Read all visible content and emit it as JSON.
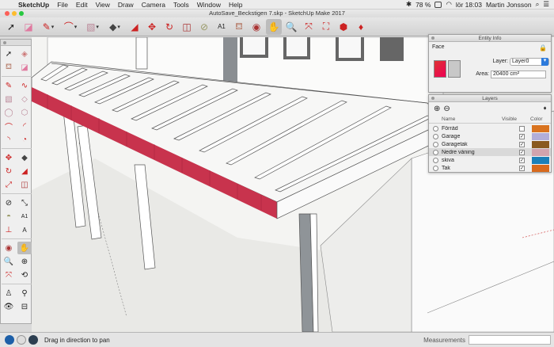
{
  "menubar": {
    "app": "SketchUp",
    "items": [
      "File",
      "Edit",
      "View",
      "Draw",
      "Camera",
      "Tools",
      "Window",
      "Help"
    ],
    "battery": "78 %",
    "clock": "lör 18:03",
    "user": "Martin Jonsson"
  },
  "window": {
    "title": "AutoSave_Beckstigen 7.skp - SketchUp Make 2017"
  },
  "toolbar_icons": [
    "select-icon",
    "eraser-icon",
    "pencil-icon",
    "arc-icon",
    "rectangle-icon",
    "push-pull-icon",
    "follow-me-icon",
    "move-icon",
    "rotate-icon",
    "offset-icon",
    "tape-measure-icon",
    "text-icon",
    "paint-bucket-icon",
    "orbit-icon",
    "pan-icon",
    "zoom-icon",
    "zoom-extents-icon",
    "warehouse-icon",
    "extension-icon",
    "ruby-icon"
  ],
  "entity_info": {
    "title": "Entity Info",
    "type": "Face",
    "layer_label": "Layer:",
    "layer_value": "Layer0",
    "area_label": "Area:",
    "area_value": "20400 cm²"
  },
  "layers_panel": {
    "title": "Layers",
    "col_name": "Name",
    "col_visible": "Visible",
    "col_color": "Color",
    "rows": [
      {
        "name": "Förråd",
        "visible": false,
        "color": "#d9731f"
      },
      {
        "name": "Garage",
        "visible": true,
        "color": "#b2aed8"
      },
      {
        "name": "Garagetak",
        "visible": true,
        "color": "#8a5a1e"
      },
      {
        "name": "Nedre våning",
        "visible": true,
        "color": "#d2a3ad"
      },
      {
        "name": "skiva",
        "visible": true,
        "color": "#1c7fb8"
      },
      {
        "name": "Tak",
        "visible": true,
        "color": "#d86a1d"
      }
    ]
  },
  "status": {
    "message": "Drag in direction to pan",
    "measurements_label": "Measurements"
  }
}
